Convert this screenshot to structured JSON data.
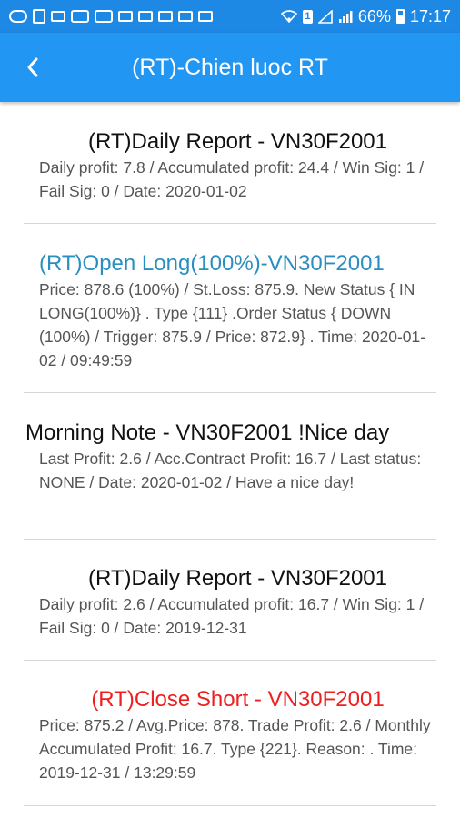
{
  "status_bar": {
    "battery_percent": "66%",
    "time": "17:17",
    "sim_label": "1"
  },
  "header": {
    "title": "(RT)-Chien luoc RT"
  },
  "feed": [
    {
      "title": "(RT)Daily Report - VN30F2001",
      "body": "Daily profit: 7.8 / Accumulated profit: 24.4 / Win Sig: 1 / Fail Sig: 0 / Date: 2020-01-02",
      "title_color": "#111111"
    },
    {
      "title": "(RT)Open Long(100%)-VN30F2001",
      "body": "Price: 878.6 (100%) / St.Loss: 875.9. New Status { IN LONG(100%)} . Type {111} .Order Status { DOWN (100%) / Trigger: 875.9 / Price: 872.9} . Time: 2020-01-02 / 09:49:59",
      "title_color": "#2a8fc0"
    },
    {
      "title": "Morning Note - VN30F2001 !Nice day",
      "body": "Last Profit: 2.6 / Acc.Contract Profit: 16.7 / Last status: NONE / Date: 2020-01-02 / Have a nice day!",
      "title_color": "#111111"
    },
    {
      "title": "(RT)Daily Report - VN30F2001",
      "body": "Daily profit: 2.6 / Accumulated profit: 16.7 / Win Sig: 1 / Fail Sig: 0 / Date: 2019-12-31",
      "title_color": "#111111"
    },
    {
      "title": "(RT)Close Short - VN30F2001",
      "body": "Price: 875.2 / Avg.Price: 878. Trade Profit: 2.6 / Monthly Accumulated Profit: 16.7. Type {221}. Reason: . Time: 2019-12-31 / 13:29:59",
      "title_color": "#f01e1e"
    }
  ],
  "colors": {
    "status_bar": "#1e88e5",
    "app_bar": "#2196f3",
    "long_signal": "#2a8fc0",
    "close_signal": "#f01e1e"
  }
}
